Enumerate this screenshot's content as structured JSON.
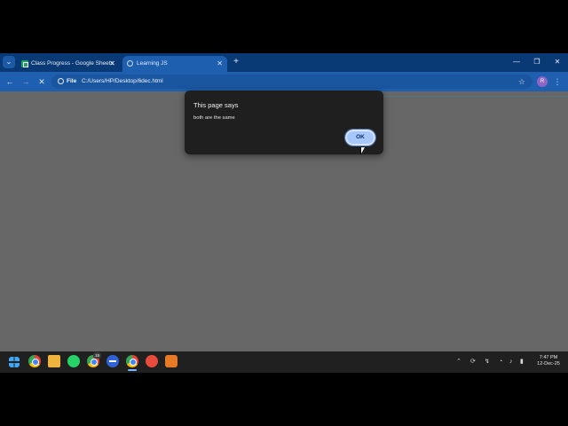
{
  "browser": {
    "tabs": [
      {
        "title": "Class Progress - Google Sheets",
        "active": false
      },
      {
        "title": "Learning JS",
        "active": true
      }
    ],
    "address": {
      "scheme_label": "File",
      "url": "C:/Users/HP/Desktop/6dec.html"
    },
    "profile_initial": "R"
  },
  "dialog": {
    "title": "This page says",
    "message": "both are the same",
    "ok_label": "OK"
  },
  "taskbar": {
    "badge_count": "15",
    "time": "7:47 PM",
    "date": "12-Dec-25"
  },
  "colors": {
    "tabstrip": "#0a3a75",
    "toolbar": "#1e5fb0",
    "page_background": "#676767",
    "dialog_background": "#1f1f1f",
    "ok_button": "#a8c7fa",
    "taskbar": "#202020"
  },
  "icons": [
    "tab-search-icon",
    "sheets-favicon",
    "close-icon",
    "new-tab-icon",
    "minimize-icon",
    "maximize-icon",
    "back-icon",
    "forward-icon",
    "stop-icon",
    "info-icon",
    "star-icon",
    "kebab-icon",
    "windows-start-icon",
    "chrome-icon",
    "file-explorer-icon",
    "whatsapp-icon",
    "sublime-text-icon"
  ]
}
